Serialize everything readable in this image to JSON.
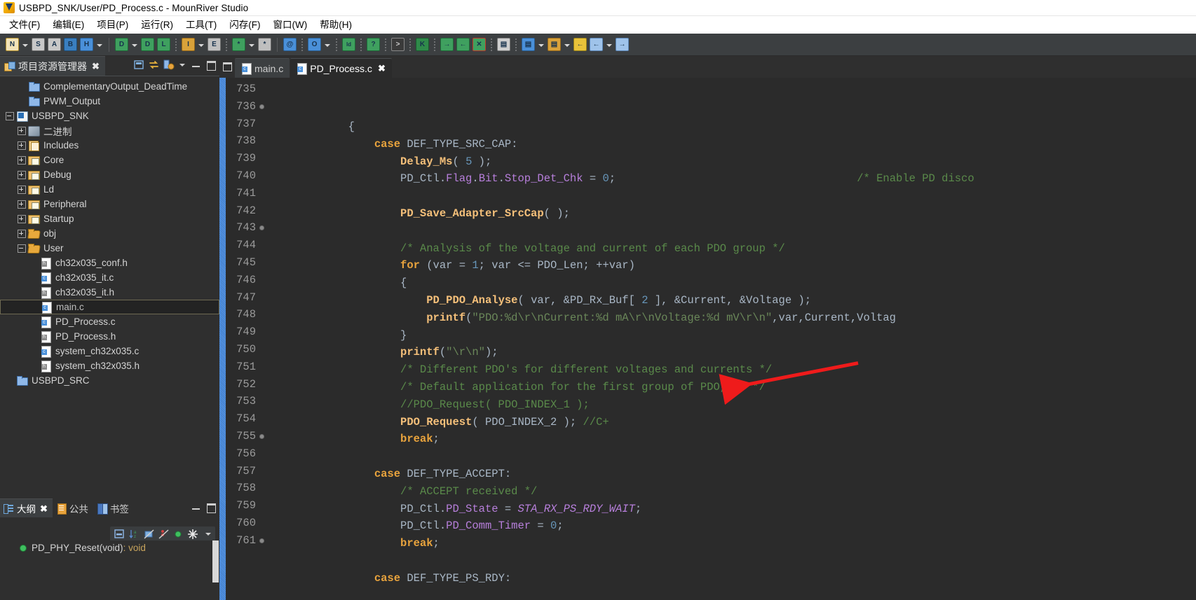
{
  "window": {
    "title": "USBPD_SNK/User/PD_Process.c - MounRiver Studio",
    "app_icon": "mounriver-logo-icon"
  },
  "menubar": {
    "items": [
      {
        "label": "文件(F)",
        "mnemonic": "F"
      },
      {
        "label": "编辑(E)",
        "mnemonic": "E"
      },
      {
        "label": "项目(P)",
        "mnemonic": "P"
      },
      {
        "label": "运行(R)",
        "mnemonic": "R"
      },
      {
        "label": "工具(T)",
        "mnemonic": "T"
      },
      {
        "label": "闪存(F)",
        "mnemonic": "F"
      },
      {
        "label": "窗口(W)",
        "mnemonic": "W"
      },
      {
        "label": "帮助(H)",
        "mnemonic": "H"
      }
    ]
  },
  "toolbar": {
    "icons": [
      "new-file-icon",
      "dropdown-caret",
      "save-icon",
      "save-all-icon",
      "build-config-icon",
      "build-all-icon",
      "dropdown-caret",
      "separator",
      "download-icon",
      "dropdown-caret",
      "download-all-icon",
      "library-icon",
      "dotted-separator",
      "import-icon",
      "dropdown-caret",
      "export-icon",
      "dotted-separator",
      "debug-bug-icon",
      "dropdown-caret",
      "debug-config-icon",
      "separator",
      "link-icon",
      "dotted-separator",
      "search-icon",
      "dropdown-caret",
      "dotted-separator",
      "ld-file-icon",
      "dotted-separator",
      "help-doc-icon",
      "dotted-separator",
      "terminal-icon",
      "dotted-separator",
      "kernel-icon",
      "dotted-separator",
      "indent-right-icon",
      "indent-left-icon",
      "clear-marks-icon",
      "dotted-separator",
      "console-icon",
      "dotted-separator",
      "save-perspective-icon",
      "dropdown-caret",
      "open-perspective-icon",
      "dropdown-caret",
      "back-yellow-icon",
      "back-arrow-icon",
      "dropdown-caret",
      "forward-arrow-icon"
    ]
  },
  "project_explorer": {
    "tab": {
      "label": "项目资源管理器",
      "icon": "project-explorer-icon",
      "close": "✖"
    },
    "tools": [
      "collapse-all-icon",
      "link-with-editor-icon",
      "view-menu-icon",
      "view-caret-icon",
      "minimize-icon",
      "maximize-icon"
    ],
    "tree": [
      {
        "label": "ComplementaryOutput_DeadTime",
        "icon": "folder-blue-icon",
        "indent": 1,
        "twisty": "none",
        "selected": false
      },
      {
        "label": "PWM_Output",
        "icon": "folder-blue-icon",
        "indent": 1,
        "twisty": "none",
        "selected": false
      },
      {
        "label": "USBPD_SNK",
        "icon": "project-icon",
        "indent": 0,
        "twisty": "minus",
        "selected": false
      },
      {
        "label": "二进制",
        "icon": "binary-icon",
        "indent": 1,
        "twisty": "plus",
        "selected": false
      },
      {
        "label": "Includes",
        "icon": "includes-icon",
        "indent": 1,
        "twisty": "plus",
        "selected": false
      },
      {
        "label": "Core",
        "icon": "folder-c-icon",
        "indent": 1,
        "twisty": "plus",
        "selected": false
      },
      {
        "label": "Debug",
        "icon": "folder-c-icon",
        "indent": 1,
        "twisty": "plus",
        "selected": false
      },
      {
        "label": "Ld",
        "icon": "folder-c-icon",
        "indent": 1,
        "twisty": "plus",
        "selected": false
      },
      {
        "label": "Peripheral",
        "icon": "folder-c-icon",
        "indent": 1,
        "twisty": "plus",
        "selected": false
      },
      {
        "label": "Startup",
        "icon": "folder-c-icon",
        "indent": 1,
        "twisty": "plus",
        "selected": false
      },
      {
        "label": "obj",
        "icon": "folder-open-icon",
        "indent": 1,
        "twisty": "plus",
        "selected": false
      },
      {
        "label": "User",
        "icon": "folder-open-icon",
        "indent": 1,
        "twisty": "minus",
        "selected": false
      },
      {
        "label": "ch32x035_conf.h",
        "icon": "h-file-icon",
        "indent": 2,
        "twisty": "none",
        "selected": false
      },
      {
        "label": "ch32x035_it.c",
        "icon": "c-file-icon",
        "indent": 2,
        "twisty": "none",
        "selected": false
      },
      {
        "label": "ch32x035_it.h",
        "icon": "h-file-icon",
        "indent": 2,
        "twisty": "none",
        "selected": false
      },
      {
        "label": "main.c",
        "icon": "c-file-icon",
        "indent": 2,
        "twisty": "none",
        "selected": true
      },
      {
        "label": "PD_Process.c",
        "icon": "c-file-icon",
        "indent": 2,
        "twisty": "none",
        "selected": false
      },
      {
        "label": "PD_Process.h",
        "icon": "h-file-icon",
        "indent": 2,
        "twisty": "none",
        "selected": false
      },
      {
        "label": "system_ch32x035.c",
        "icon": "c-file-icon",
        "indent": 2,
        "twisty": "none",
        "selected": false
      },
      {
        "label": "system_ch32x035.h",
        "icon": "h-file-icon",
        "indent": 2,
        "twisty": "none",
        "selected": false
      },
      {
        "label": "USBPD_SRC",
        "icon": "folder-blue-icon",
        "indent": 0,
        "twisty": "none",
        "selected": false
      }
    ]
  },
  "outline_panel": {
    "tabs": [
      {
        "label": "大纲",
        "icon": "outline-icon",
        "active": true,
        "close": "✖"
      },
      {
        "label": "公共",
        "icon": "public-icon",
        "active": false
      },
      {
        "label": "书签",
        "icon": "bookmark-icon",
        "active": false
      }
    ],
    "tools": [
      "collapse-all-icon",
      "sort-icon",
      "hide-fields-icon",
      "hide-static-icon",
      "hide-nonpublic-icon",
      "filters-icon",
      "view-caret-icon"
    ],
    "header_tools": [
      "minimize-icon",
      "maximize-icon"
    ],
    "items": [
      {
        "label": "PD_PHY_Reset(void)",
        "return_type": " : void",
        "icon": "green-dot-icon"
      }
    ]
  },
  "editor": {
    "tabs": [
      {
        "label": "main.c",
        "icon": "c-file-icon",
        "active": false
      },
      {
        "label": "PD_Process.c",
        "icon": "c-file-icon",
        "active": true,
        "close": "✖"
      }
    ],
    "minimize_icon": "minimize-icon",
    "first_line_number": 735,
    "lines": [
      {
        "n": 735,
        "bp": false,
        "tokens": [
          {
            "t": "            {",
            "c": "pl"
          }
        ]
      },
      {
        "n": 736,
        "bp": true,
        "tokens": [
          {
            "t": "                ",
            "c": "pl"
          },
          {
            "t": "case",
            "c": "kw"
          },
          {
            "t": " DEF_TYPE_SRC_CAP:",
            "c": "id"
          }
        ]
      },
      {
        "n": 737,
        "bp": false,
        "tokens": [
          {
            "t": "                    ",
            "c": "pl"
          },
          {
            "t": "Delay_Ms",
            "c": "fn"
          },
          {
            "t": "( ",
            "c": "id"
          },
          {
            "t": "5",
            "c": "num"
          },
          {
            "t": " );",
            "c": "id"
          }
        ]
      },
      {
        "n": 738,
        "bp": false,
        "tokens": [
          {
            "t": "                    ",
            "c": "pl"
          },
          {
            "t": "PD_Ctl.",
            "c": "id"
          },
          {
            "t": "Flag",
            "c": "fld"
          },
          {
            "t": ".",
            "c": "id"
          },
          {
            "t": "Bit",
            "c": "fld"
          },
          {
            "t": ".",
            "c": "id"
          },
          {
            "t": "Stop_Det_Chk",
            "c": "fld"
          },
          {
            "t": " = ",
            "c": "id"
          },
          {
            "t": "0",
            "c": "num"
          },
          {
            "t": ";",
            "c": "id"
          },
          {
            "t": "                                     /* Enable PD disco",
            "c": "cm"
          }
        ]
      },
      {
        "n": 739,
        "bp": false,
        "tokens": []
      },
      {
        "n": 740,
        "bp": false,
        "tokens": [
          {
            "t": "                    ",
            "c": "pl"
          },
          {
            "t": "PD_Save_Adapter_SrcCap",
            "c": "fn"
          },
          {
            "t": "( );",
            "c": "id"
          }
        ]
      },
      {
        "n": 741,
        "bp": false,
        "tokens": []
      },
      {
        "n": 742,
        "bp": false,
        "tokens": [
          {
            "t": "                    /* Analysis of the voltage and current of each PDO group */",
            "c": "cm"
          }
        ]
      },
      {
        "n": 743,
        "bp": true,
        "tokens": [
          {
            "t": "                    ",
            "c": "pl"
          },
          {
            "t": "for",
            "c": "kw"
          },
          {
            "t": " (var = ",
            "c": "id"
          },
          {
            "t": "1",
            "c": "num"
          },
          {
            "t": "; var <= PDO_Len; ++var)",
            "c": "id"
          }
        ]
      },
      {
        "n": 744,
        "bp": false,
        "tokens": [
          {
            "t": "                    {",
            "c": "id"
          }
        ]
      },
      {
        "n": 745,
        "bp": false,
        "tokens": [
          {
            "t": "                        ",
            "c": "pl"
          },
          {
            "t": "PD_PDO_Analyse",
            "c": "fn"
          },
          {
            "t": "( var, &PD_Rx_Buf[ ",
            "c": "id"
          },
          {
            "t": "2",
            "c": "num"
          },
          {
            "t": " ], &Current, &Voltage );",
            "c": "id"
          }
        ]
      },
      {
        "n": 746,
        "bp": false,
        "tokens": [
          {
            "t": "                        ",
            "c": "pl"
          },
          {
            "t": "printf",
            "c": "fn"
          },
          {
            "t": "(",
            "c": "id"
          },
          {
            "t": "\"PDO:%d\\r\\nCurrent:%d mA\\r\\nVoltage:%d mV\\r\\n\"",
            "c": "st"
          },
          {
            "t": ",var,Current,Voltag",
            "c": "id"
          }
        ]
      },
      {
        "n": 747,
        "bp": false,
        "tokens": [
          {
            "t": "                    }",
            "c": "id"
          }
        ]
      },
      {
        "n": 748,
        "bp": false,
        "tokens": [
          {
            "t": "                    ",
            "c": "pl"
          },
          {
            "t": "printf",
            "c": "fn"
          },
          {
            "t": "(",
            "c": "id"
          },
          {
            "t": "\"\\r\\n\"",
            "c": "st"
          },
          {
            "t": ");",
            "c": "id"
          }
        ]
      },
      {
        "n": 749,
        "bp": false,
        "tokens": [
          {
            "t": "                    /* Different PDO's for different voltages and currents */",
            "c": "cm"
          }
        ]
      },
      {
        "n": 750,
        "bp": false,
        "tokens": [
          {
            "t": "                    /* Default application for the first group of PDO, 5V */",
            "c": "cm"
          }
        ]
      },
      {
        "n": 751,
        "bp": false,
        "tokens": [
          {
            "t": "                    //PDO_Request( PDO_INDEX_1 );",
            "c": "cm"
          }
        ]
      },
      {
        "n": 752,
        "bp": false,
        "tokens": [
          {
            "t": "                    ",
            "c": "pl"
          },
          {
            "t": "PDO_Request",
            "c": "fn"
          },
          {
            "t": "( PDO_INDEX_2 );",
            "c": "id"
          },
          {
            "t": " //C+",
            "c": "cm"
          }
        ]
      },
      {
        "n": 753,
        "bp": false,
        "tokens": [
          {
            "t": "                    ",
            "c": "pl"
          },
          {
            "t": "break",
            "c": "kw"
          },
          {
            "t": ";",
            "c": "id"
          }
        ]
      },
      {
        "n": 754,
        "bp": false,
        "tokens": []
      },
      {
        "n": 755,
        "bp": true,
        "tokens": [
          {
            "t": "                ",
            "c": "pl"
          },
          {
            "t": "case",
            "c": "kw"
          },
          {
            "t": " DEF_TYPE_ACCEPT:",
            "c": "id"
          }
        ]
      },
      {
        "n": 756,
        "bp": false,
        "tokens": [
          {
            "t": "                    /* ACCEPT received */",
            "c": "cm"
          }
        ]
      },
      {
        "n": 757,
        "bp": false,
        "tokens": [
          {
            "t": "                    ",
            "c": "pl"
          },
          {
            "t": "PD_Ctl.",
            "c": "id"
          },
          {
            "t": "PD_State",
            "c": "fld"
          },
          {
            "t": " = ",
            "c": "id"
          },
          {
            "t": "STA_RX_PS_RDY_WAIT",
            "c": "it"
          },
          {
            "t": ";",
            "c": "id"
          }
        ]
      },
      {
        "n": 758,
        "bp": false,
        "tokens": [
          {
            "t": "                    ",
            "c": "pl"
          },
          {
            "t": "PD_Ctl.",
            "c": "id"
          },
          {
            "t": "PD_Comm_Timer",
            "c": "fld"
          },
          {
            "t": " = ",
            "c": "id"
          },
          {
            "t": "0",
            "c": "num"
          },
          {
            "t": ";",
            "c": "id"
          }
        ]
      },
      {
        "n": 759,
        "bp": false,
        "tokens": [
          {
            "t": "                    ",
            "c": "pl"
          },
          {
            "t": "break",
            "c": "kw"
          },
          {
            "t": ";",
            "c": "id"
          }
        ]
      },
      {
        "n": 760,
        "bp": false,
        "tokens": []
      },
      {
        "n": 761,
        "bp": true,
        "tokens": [
          {
            "t": "                ",
            "c": "pl"
          },
          {
            "t": "case",
            "c": "kw"
          },
          {
            "t": " DEF_TYPE_PS_RDY:",
            "c": "id"
          }
        ]
      }
    ]
  },
  "annotation": {
    "type": "red-arrow",
    "color": "#ef1b1b",
    "points_to_line": 752,
    "points_to_text": "//C+"
  },
  "colors": {
    "editor_bg": "#2b2b2b",
    "panel_bg": "#2f2f2f",
    "toolbar_bg": "#3c3f41",
    "titlebar_bg": "#ffffff",
    "keyword": "#e8a33d",
    "function": "#f5c07a",
    "comment": "#5a8a4a",
    "identifier": "#a9b7c6",
    "number": "#6897bb",
    "field": "#b77fdb",
    "string": "#6a8759",
    "annotation_red": "#ef1b1b"
  }
}
